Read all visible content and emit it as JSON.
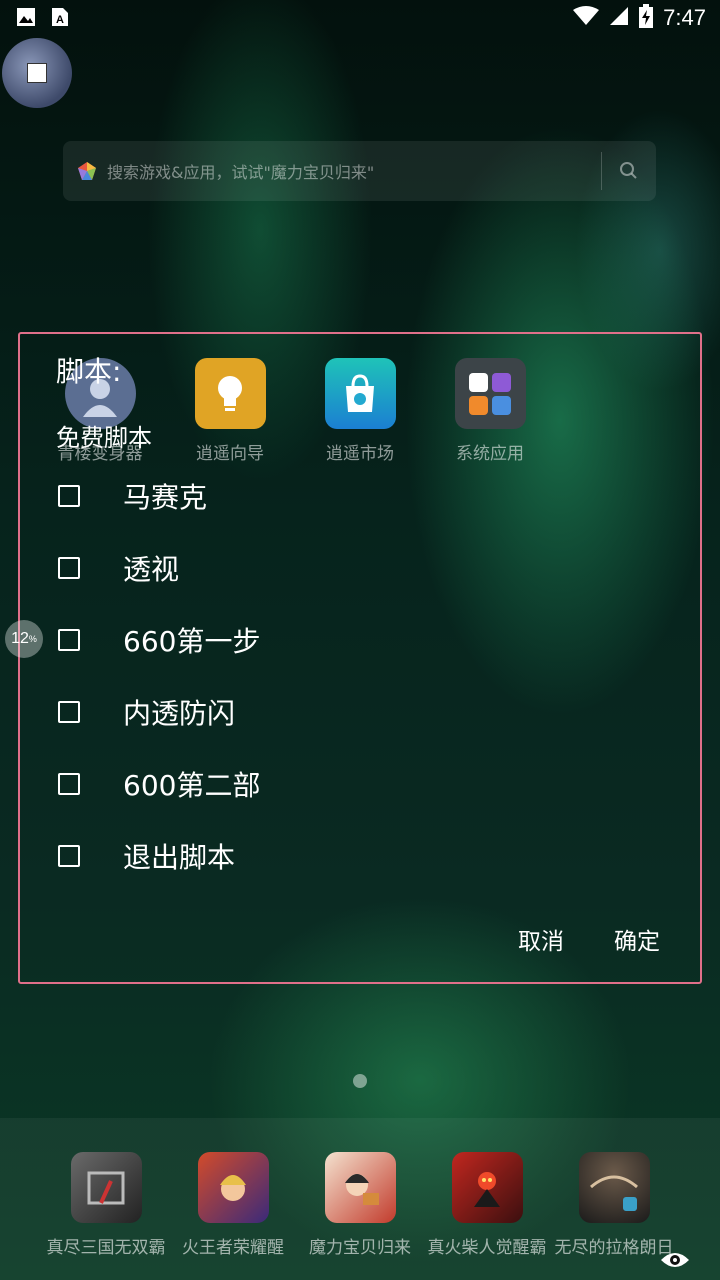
{
  "status_bar": {
    "time": "7:47"
  },
  "search": {
    "placeholder": "搜索游戏&应用，试试\"魔力宝贝归来\""
  },
  "apps": [
    {
      "label": "青楼变身器",
      "icon": "avatar-icon",
      "color": "#5b6e92"
    },
    {
      "label": "逍遥向导",
      "icon": "lightbulb-icon",
      "color": "#e0a425"
    },
    {
      "label": "逍遥市场",
      "icon": "store-bag-icon",
      "color": "#23a9d0"
    },
    {
      "label": "系统应用",
      "icon": "folder-icon",
      "color": "#3c4448"
    }
  ],
  "dialog": {
    "title": "脚本:",
    "subtitle": "免费脚本",
    "options": [
      "马赛克",
      "透视",
      "660第一步",
      "内透防闪",
      "600第二部",
      "退出脚本"
    ],
    "cancel": "取消",
    "confirm": "确定",
    "border_color": "#e0708a"
  },
  "progress": {
    "value": "12",
    "unit": "%"
  },
  "dock": [
    {
      "label": "真尽三国无双霸",
      "icon": "game-sanguo-icon"
    },
    {
      "label": "火王者荣耀醒",
      "icon": "game-honor-icon"
    },
    {
      "label": "魔力宝贝归来",
      "icon": "game-moli-icon"
    },
    {
      "label": "真火柴人觉醒霸",
      "icon": "game-stickman-icon"
    },
    {
      "label": "无尽的拉格朗日",
      "icon": "game-lagrange-icon"
    }
  ]
}
